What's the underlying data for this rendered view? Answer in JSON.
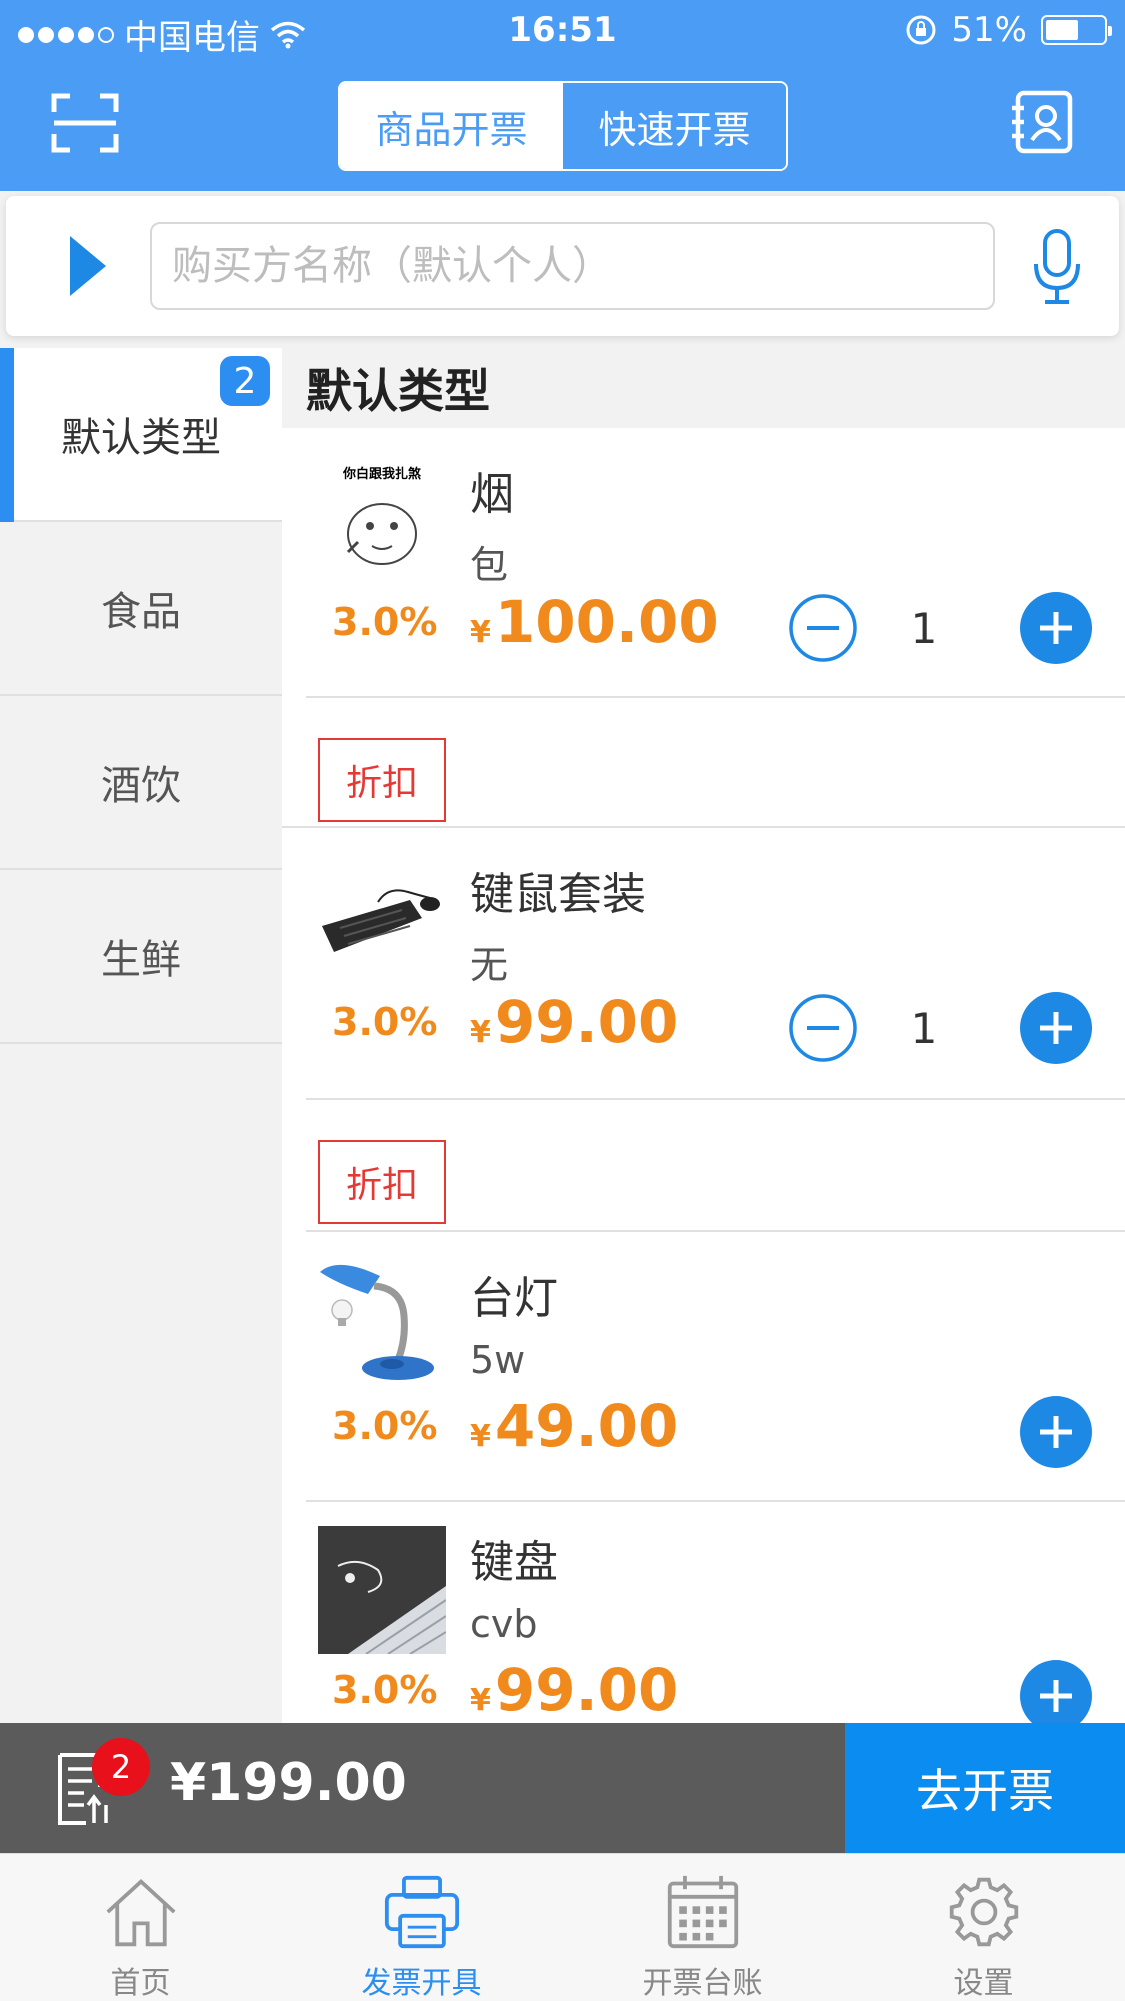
{
  "status_bar": {
    "carrier": "中国电信",
    "time": "16:51",
    "battery_percent": "51%"
  },
  "header": {
    "segment_tabs": [
      "商品开票",
      "快速开票"
    ],
    "active_segment": 0
  },
  "buyer": {
    "placeholder": "购买方名称（默认个人）"
  },
  "sidebar": {
    "categories": [
      {
        "label": "默认类型",
        "badge": "2"
      },
      {
        "label": "食品"
      },
      {
        "label": "酒饮"
      },
      {
        "label": "生鲜"
      }
    ]
  },
  "list": {
    "section_title": "默认类型",
    "discount_label": "折扣",
    "currency": "¥",
    "items": [
      {
        "name": "烟",
        "unit": "包",
        "rate": "3.0%",
        "price": "100.00",
        "qty": "1",
        "thumb_text": "你白跟我扎煞"
      },
      {
        "name": "键鼠套装",
        "unit": "无",
        "rate": "3.0%",
        "price": "99.00",
        "qty": "1"
      },
      {
        "name": "台灯",
        "unit": "5w",
        "rate": "3.0%",
        "price": "49.00"
      },
      {
        "name": "键盘",
        "unit": "cvb",
        "rate": "3.0%",
        "price": "99.00"
      }
    ]
  },
  "checkout": {
    "count_badge": "2",
    "total": "¥199.00",
    "go_button": "去开票"
  },
  "tabbar": {
    "tabs": [
      {
        "label": "首页",
        "icon": "home-icon"
      },
      {
        "label": "发票开具",
        "icon": "printer-icon"
      },
      {
        "label": "开票台账",
        "icon": "calendar-icon"
      },
      {
        "label": "设置",
        "icon": "gear-icon"
      }
    ],
    "active_index": 1
  },
  "colors": {
    "header_blue": "#4a9cf5",
    "accent_blue": "#2b8ef0",
    "price_orange": "#f08a1c",
    "discount_red": "#e53935",
    "checkout_gray": "#5b5b5b"
  }
}
